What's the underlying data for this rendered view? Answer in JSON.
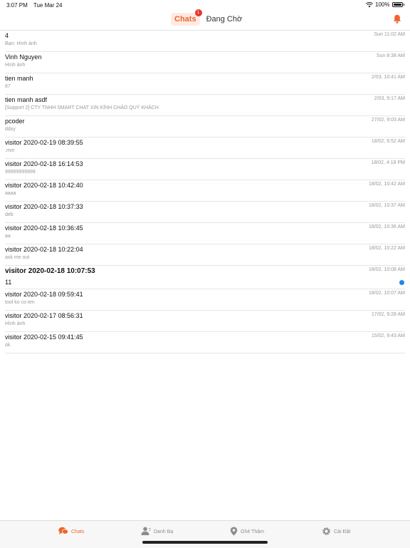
{
  "status_bar": {
    "time": "3:07 PM",
    "date": "Tue Mar 24",
    "battery": "100%"
  },
  "header": {
    "tabs": [
      {
        "label": "Chats",
        "badge": "1"
      },
      {
        "label": "Đang Chờ"
      }
    ]
  },
  "chats": [
    {
      "name": "4",
      "preview": "Bạn: Hình ảnh",
      "time": "Sun 11:02 AM"
    },
    {
      "name": "Vinh Nguyen",
      "preview": "Hình ảnh",
      "time": "Sun 8:38 AM"
    },
    {
      "name": "tien manh",
      "preview": "87",
      "time": "2/03, 10:41 AM"
    },
    {
      "name": "tien manh asdf",
      "preview": "[Support 2] CTY TNHH SMART CHAT XIN KÍNH CHÀO QUÝ KHÁCH",
      "time": "2/03, 9:17 AM"
    },
    {
      "name": "pcoder",
      "preview": "ddxy",
      "time": "27/02, 9:03 AM"
    },
    {
      "name": "visitor 2020-02-19 08:39:55",
      "preview": ".mm",
      "time": "18/02, 6:52 AM"
    },
    {
      "name": "visitor 2020-02-18 16:14:53",
      "preview": "99999999999",
      "time": "18/02, 4:18 PM"
    },
    {
      "name": "visitor 2020-02-18 10:42:40",
      "preview": "aaaa",
      "time": "18/02, 10:42 AM"
    },
    {
      "name": "visitor 2020-02-18 10:37:33",
      "preview": "deb",
      "time": "18/02, 10:37 AM"
    },
    {
      "name": "visitor 2020-02-18 10:36:45",
      "preview": "aa",
      "time": "18/02, 10:36 AM"
    },
    {
      "name": "visitor 2020-02-18 10:22:04",
      "preview": "ask me out",
      "time": "18/02, 10:22 AM"
    },
    {
      "name": "visitor 2020-02-18 10:07:53",
      "preview": "11",
      "time": "18/02, 10:08 AM",
      "unread": true
    },
    {
      "name": "visitor 2020-02-18 09:59:41",
      "preview": "tool ko co ten",
      "time": "18/02, 10:07 AM"
    },
    {
      "name": "visitor 2020-02-17 08:56:31",
      "preview": "Hình ảnh",
      "time": "17/02, 9:28 AM"
    },
    {
      "name": "visitor 2020-02-15 09:41:45",
      "preview": "ok",
      "time": "15/02, 9:43 AM"
    }
  ],
  "tab_bar": {
    "items": [
      {
        "label": "Chats",
        "icon": "chat-bubbles-icon",
        "active": true
      },
      {
        "label": "Danh Bạ",
        "icon": "contacts-icon"
      },
      {
        "label": "Ghé Thăm",
        "icon": "location-pin-icon"
      },
      {
        "label": "Cài Đặt",
        "icon": "gear-icon"
      }
    ]
  },
  "colors": {
    "accent": "#f0632b",
    "badge": "#e8352c",
    "unread_dot": "#1e88e5"
  }
}
